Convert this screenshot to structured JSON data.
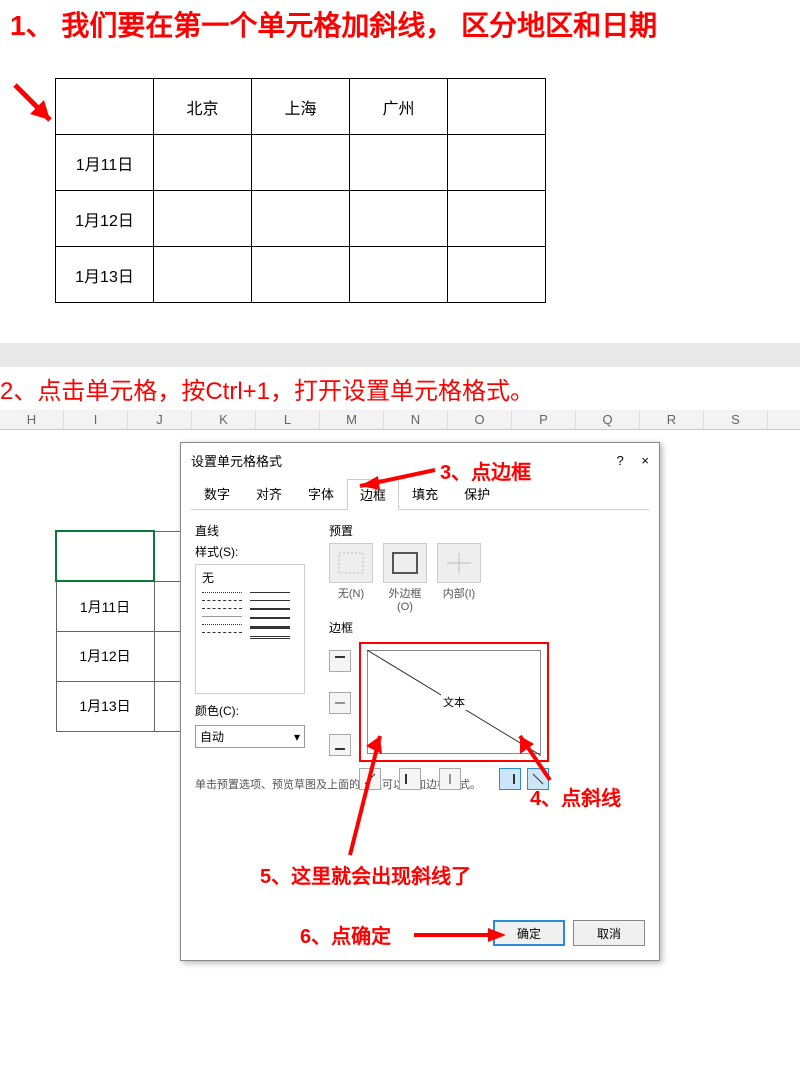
{
  "step1": "1、 我们要在第一个单元格加斜线， 区分地区和日期",
  "table_headers": [
    "",
    "北京",
    "上海",
    "广州",
    ""
  ],
  "table_rows": [
    "1月11日",
    "1月12日",
    "1月13日"
  ],
  "step2": "2、点击单元格，按Ctrl+1，打开设置单元格格式。",
  "columns": [
    "H",
    "I",
    "J",
    "K",
    "L",
    "M",
    "N",
    "O",
    "P",
    "Q",
    "R",
    "S"
  ],
  "dialog": {
    "title": "设置单元格格式",
    "help": "?",
    "close": "×",
    "tabs": [
      "数字",
      "对齐",
      "字体",
      "边框",
      "填充",
      "保护"
    ],
    "line_section": "直线",
    "style_label": "样式(S):",
    "style_none": "无",
    "color_label": "颜色(C):",
    "color_auto": "自动",
    "preset_label": "预置",
    "preset_none": "无(N)",
    "preset_outer": "外边框(O)",
    "preset_inner": "内部(I)",
    "border_label": "边框",
    "preview_text": "文本",
    "hint": "单击预置选项、预览草图及上面的按钮可以添加边框样式。",
    "ok": "确定",
    "cancel": "取消"
  },
  "anno3": "3、点边框",
  "anno4": "4、点斜线",
  "anno5": "5、这里就会出现斜线了",
  "anno6": "6、点确定"
}
